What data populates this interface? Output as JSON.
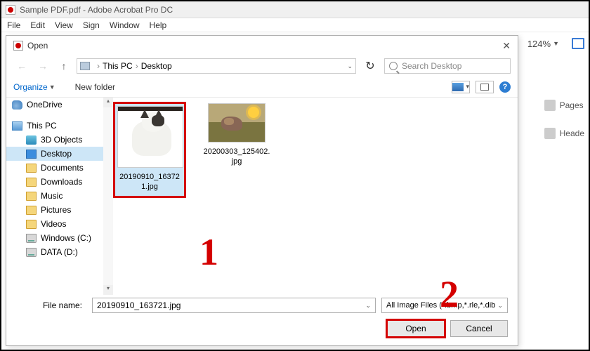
{
  "acrobat": {
    "title": "Sample PDF.pdf - Adobe Acrobat Pro DC",
    "menu": [
      "File",
      "Edit",
      "View",
      "Sign",
      "Window",
      "Help"
    ],
    "zoom": "124%",
    "side": {
      "pages": "Pages",
      "header": "Heade"
    }
  },
  "dialog": {
    "title": "Open",
    "breadcrumb": {
      "root": "This PC",
      "leaf": "Desktop"
    },
    "search_placeholder": "Search Desktop",
    "organize": "Organize",
    "new_folder": "New folder",
    "tree": {
      "onedrive": "OneDrive",
      "this_pc": "This PC",
      "items": [
        "3D Objects",
        "Desktop",
        "Documents",
        "Downloads",
        "Music",
        "Pictures",
        "Videos",
        "Windows (C:)",
        "DATA (D:)"
      ]
    },
    "files": [
      {
        "name": "20190910_163721.jpg",
        "selected": true
      },
      {
        "name": "20200303_125402.jpg",
        "selected": false
      }
    ],
    "filename_label": "File name:",
    "filename_value": "20190910_163721.jpg",
    "filetype": "All Image Files (*.bmp,*.rle,*.dib",
    "open_btn": "Open",
    "cancel_btn": "Cancel"
  },
  "annotations": {
    "one": "1",
    "two": "2"
  }
}
